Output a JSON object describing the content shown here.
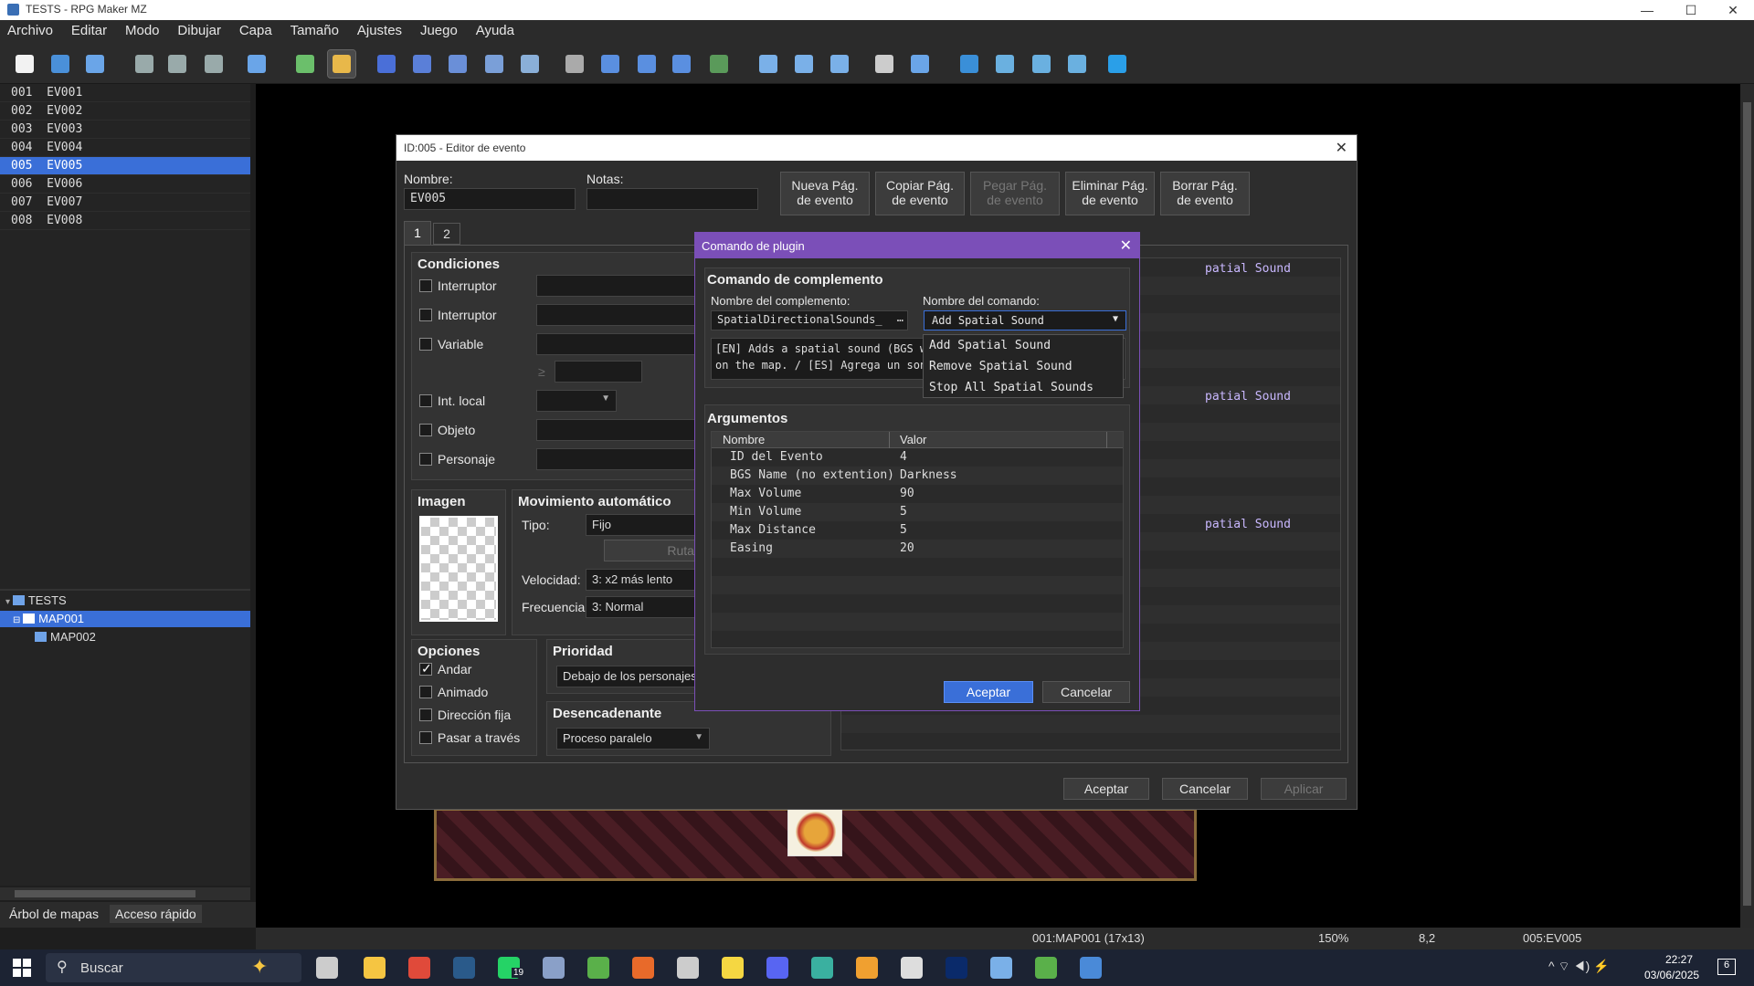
{
  "window": {
    "title": "TESTS - RPG Maker MZ",
    "minimize": "—",
    "maximize": "☐",
    "close": "✕"
  },
  "menu": [
    "Archivo",
    "Editar",
    "Modo",
    "Dibujar",
    "Capa",
    "Tamaño",
    "Ajustes",
    "Juego",
    "Ayuda"
  ],
  "toolbar_icons": [
    "new-project-icon",
    "open-project-icon",
    "save-project-icon",
    "cut-icon",
    "copy-icon",
    "paste-icon",
    "undo-icon",
    "map-mode-icon",
    "event-mode-icon",
    "layer1-icon",
    "layer2-icon",
    "layer3-icon",
    "layer4-icon",
    "layer-auto-icon",
    "pencil-icon",
    "rectangle-icon",
    "ellipse-icon",
    "fill-icon",
    "shadow-pen-icon",
    "zoom-in-icon",
    "zoom-out-icon",
    "zoom-actual-icon",
    "database-icon",
    "plugin-manager-icon",
    "sound-test-icon",
    "event-searcher-icon",
    "resource-manager-icon",
    "character-generator-icon",
    "playtest-icon"
  ],
  "events": [
    {
      "id": "001",
      "name": "EV001"
    },
    {
      "id": "002",
      "name": "EV002"
    },
    {
      "id": "003",
      "name": "EV003"
    },
    {
      "id": "004",
      "name": "EV004"
    },
    {
      "id": "005",
      "name": "EV005"
    },
    {
      "id": "006",
      "name": "EV006"
    },
    {
      "id": "007",
      "name": "EV007"
    },
    {
      "id": "008",
      "name": "EV008"
    }
  ],
  "map_tree": {
    "project": "TESTS",
    "maps": [
      "MAP001",
      "MAP002"
    ]
  },
  "left_tabs": {
    "tree": "Árbol de mapas",
    "quick": "Acceso rápido"
  },
  "status": {
    "map": "001:MAP001 (17x13)",
    "zoom": "150%",
    "coords": "8,2",
    "event": "005:EV005"
  },
  "taskbar": {
    "search": "Buscar",
    "time": "22:27",
    "date": "03/06/2025",
    "badge": "19",
    "notif": "6"
  },
  "event_editor": {
    "title": "ID:005 - Editor de evento",
    "name_label": "Nombre:",
    "name_value": "EV005",
    "notes_label": "Notas:",
    "notes_value": "",
    "page_buttons": [
      {
        "line1": "Nueva Pág.",
        "line2": "de evento"
      },
      {
        "line1": "Copiar Pág.",
        "line2": "de evento"
      },
      {
        "line1": "Pegar Pág.",
        "line2": "de evento"
      },
      {
        "line1": "Eliminar Pág.",
        "line2": "de evento"
      },
      {
        "line1": "Borrar Pág.",
        "line2": "de evento"
      }
    ],
    "tabs": [
      "1",
      "2"
    ],
    "conditions_title": "Condiciones",
    "conditions": [
      "Interruptor",
      "Interruptor",
      "Variable",
      "Int. local",
      "Objeto",
      "Personaje"
    ],
    "ge_symbol": "≥",
    "image_title": "Imagen",
    "movement_title": "Movimiento automático",
    "type_label": "Tipo:",
    "type_value": "Fijo",
    "route_button": "Ruta...",
    "speed_label": "Velocidad:",
    "speed_value": "3: x2 más lento",
    "freq_label": "Frecuencia:",
    "freq_value": "3: Normal",
    "options_title": "Opciones",
    "options": [
      {
        "label": "Andar",
        "checked": true
      },
      {
        "label": "Animado",
        "checked": false
      },
      {
        "label": "Dirección fija",
        "checked": false
      },
      {
        "label": "Pasar a través",
        "checked": false
      }
    ],
    "priority_title": "Prioridad",
    "priority_value": "Debajo de los personajes",
    "trigger_title": "Desencadenante",
    "trigger_value": "Proceso paralelo",
    "command_lines": [
      "patial Sound",
      "patial Sound",
      "patial Sound"
    ],
    "ok": "Aceptar",
    "cancel": "Cancelar",
    "apply": "Aplicar"
  },
  "plugin_dialog": {
    "title": "Comando de plugin",
    "section": "Comando de complemento",
    "plugin_label": "Nombre del complemento:",
    "plugin_value": "SpatialDirectionalSounds_",
    "plugin_more": "…",
    "command_label": "Nombre del comando:",
    "command_value": "Add Spatial Sound",
    "description_line1": "[EN] Adds a spatial sound (BGS w",
    "description_line2": "on the map. / [ES] Agrega un son",
    "args_title": "Argumentos",
    "col_name": "Nombre",
    "col_value": "Valor",
    "args": [
      {
        "name": "ID del Evento",
        "value": "4"
      },
      {
        "name": "BGS Name (no extention)",
        "value": "Darkness"
      },
      {
        "name": "Max Volume",
        "value": "90"
      },
      {
        "name": "Min Volume",
        "value": "5"
      },
      {
        "name": "Max Distance",
        "value": "5"
      },
      {
        "name": "Easing",
        "value": "20"
      }
    ],
    "ok": "Aceptar",
    "cancel": "Cancelar",
    "dropdown_options": [
      "Add Spatial Sound",
      "Remove Spatial Sound",
      "Stop All Spatial Sounds"
    ]
  },
  "colors": {
    "selection": "#3a6fd8",
    "plugin_accent": "#7b4fb8"
  }
}
